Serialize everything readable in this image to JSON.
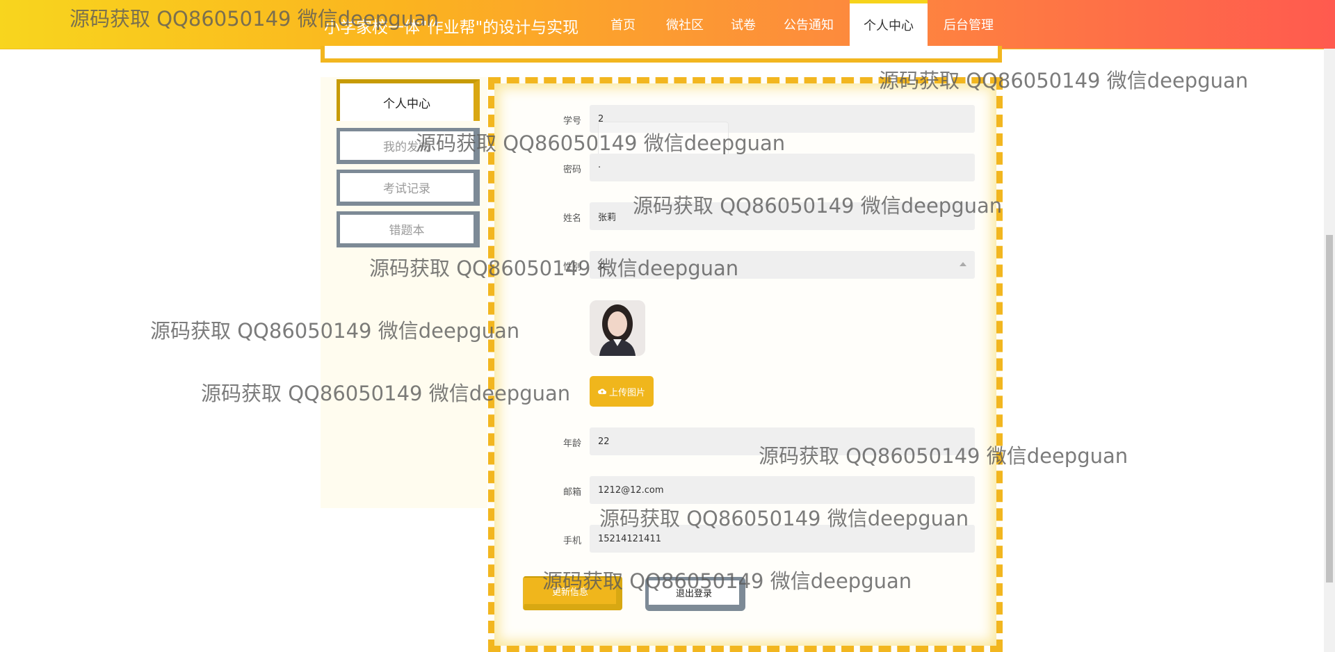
{
  "header": {
    "site_title": "小学家校一体\"作业帮\"的设计与实现",
    "nav": [
      {
        "label": "首页"
      },
      {
        "label": "微社区"
      },
      {
        "label": "试卷"
      },
      {
        "label": "公告通知"
      },
      {
        "label": "个人中心",
        "active": true
      },
      {
        "label": "后台管理"
      }
    ]
  },
  "sidebar": {
    "items": [
      {
        "label": "个人中心",
        "active": true
      },
      {
        "label": "我的发布"
      },
      {
        "label": "考试记录"
      },
      {
        "label": "错题本"
      }
    ]
  },
  "form": {
    "fields": {
      "student_id": {
        "label": "学号",
        "value": "2"
      },
      "password": {
        "label": "密码",
        "value": "·"
      },
      "name": {
        "label": "姓名",
        "value": "张莉"
      },
      "gender": {
        "label": "性别",
        "value": "女"
      },
      "age": {
        "label": "年龄",
        "value": "22"
      },
      "email": {
        "label": "邮箱",
        "value": "1212@12.com"
      },
      "phone": {
        "label": "手机",
        "value": "15214121411"
      }
    },
    "upload_label": "上传图片",
    "update_label": "更新信息",
    "logout_label": "退出登录"
  },
  "watermark_text": "源码获取 QQ86050149 微信deepguan",
  "colors": {
    "accent": "#f0b61c",
    "nav_gradient_start": "#f8d51e",
    "nav_gradient_end": "#ff5a4f",
    "side_border": "#7d8a96"
  }
}
